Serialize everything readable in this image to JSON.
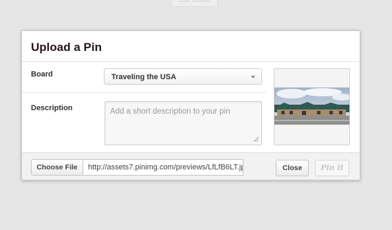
{
  "background": {
    "button_label": "Edit Board"
  },
  "modal": {
    "title": "Upload a Pin",
    "board": {
      "label": "Board",
      "selected": "Traveling the USA"
    },
    "description": {
      "label": "Description",
      "placeholder": "Add a short description to your pin"
    },
    "footer": {
      "choose_file_label": "Choose File",
      "file_path": "http://assets7.pinimg.com/previews/LfLfB6LT.jp",
      "close_label": "Close",
      "pin_label": "Pin it"
    }
  },
  "colors": {
    "title": "#221919",
    "background": "#e6e6e6",
    "footer": "#f2f2f2"
  }
}
